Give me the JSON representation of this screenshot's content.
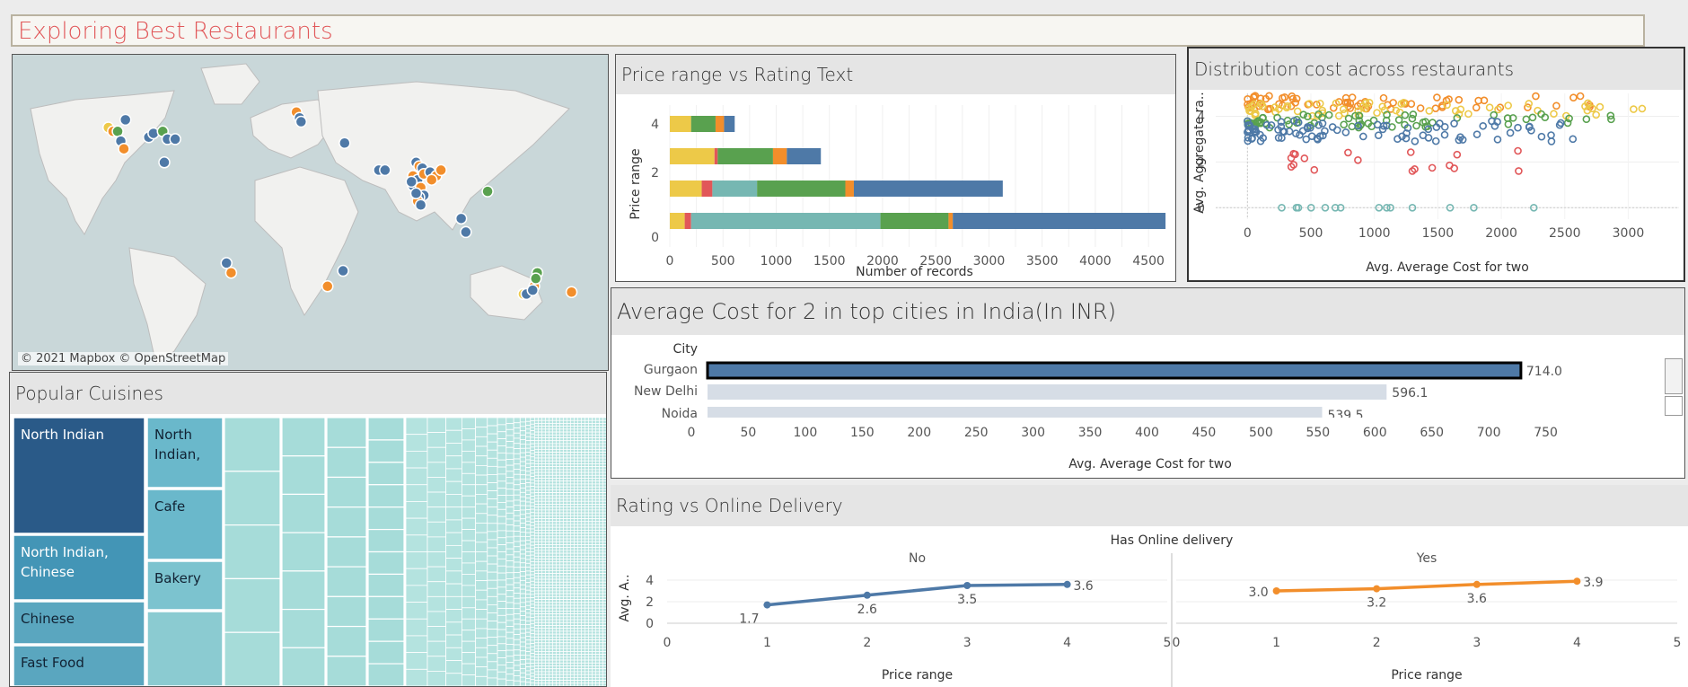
{
  "dashboard": {
    "title": "Exploring Best Restaurants"
  },
  "colors": {
    "blue": "#4e79a7",
    "orange": "#f28e2b",
    "green": "#59a14f",
    "yellow": "#edc948",
    "red": "#e15759",
    "teal": "#76b7b2",
    "light": "#d6dde6",
    "title": "#e15759"
  },
  "map": {
    "attribution": "© 2021 Mapbox © OpenStreetMap",
    "points": [
      {
        "lon": -123,
        "lat": 48,
        "c": "yellow"
      },
      {
        "lon": -120,
        "lat": 46,
        "c": "orange"
      },
      {
        "lon": -117,
        "lat": 46,
        "c": "green"
      },
      {
        "lon": -112,
        "lat": 52,
        "c": "blue"
      },
      {
        "lon": -115,
        "lat": 41,
        "c": "blue"
      },
      {
        "lon": -113,
        "lat": 37,
        "c": "orange"
      },
      {
        "lon": -97,
        "lat": 43,
        "c": "blue"
      },
      {
        "lon": -94,
        "lat": 45,
        "c": "blue"
      },
      {
        "lon": -88,
        "lat": 46,
        "c": "green"
      },
      {
        "lon": -85,
        "lat": 42,
        "c": "blue"
      },
      {
        "lon": -80,
        "lat": 42,
        "c": "blue"
      },
      {
        "lon": -87,
        "lat": 30,
        "c": "blue"
      },
      {
        "lon": -47,
        "lat": -22,
        "c": "blue"
      },
      {
        "lon": -44,
        "lat": -27,
        "c": "orange"
      },
      {
        "lon": -2,
        "lat": 56,
        "c": "orange"
      },
      {
        "lon": 0,
        "lat": 53,
        "c": "blue"
      },
      {
        "lon": 1,
        "lat": 51,
        "c": "blue"
      },
      {
        "lon": 29,
        "lat": 40,
        "c": "blue"
      },
      {
        "lon": 51,
        "lat": 26,
        "c": "blue"
      },
      {
        "lon": 55,
        "lat": 26,
        "c": "blue"
      },
      {
        "lon": 75,
        "lat": 30,
        "c": "blue"
      },
      {
        "lon": 77,
        "lat": 28,
        "c": "orange"
      },
      {
        "lon": 79,
        "lat": 27,
        "c": "blue"
      },
      {
        "lon": 73,
        "lat": 23,
        "c": "orange"
      },
      {
        "lon": 76,
        "lat": 21,
        "c": "blue"
      },
      {
        "lon": 80,
        "lat": 24,
        "c": "orange"
      },
      {
        "lon": 84,
        "lat": 25,
        "c": "blue"
      },
      {
        "lon": 88,
        "lat": 23,
        "c": "orange"
      },
      {
        "lon": 73,
        "lat": 18,
        "c": "blue"
      },
      {
        "lon": 78,
        "lat": 17,
        "c": "orange"
      },
      {
        "lon": 80,
        "lat": 13,
        "c": "blue"
      },
      {
        "lon": 77,
        "lat": 12,
        "c": "blue"
      },
      {
        "lon": 76,
        "lat": 10,
        "c": "orange"
      },
      {
        "lon": 78,
        "lat": 8,
        "c": "blue"
      },
      {
        "lon": 75,
        "lat": 14,
        "c": "blue"
      },
      {
        "lon": 72,
        "lat": 20,
        "c": "blue"
      },
      {
        "lon": 85,
        "lat": 21,
        "c": "orange"
      },
      {
        "lon": 91,
        "lat": 26,
        "c": "orange"
      },
      {
        "lon": 121,
        "lat": 15,
        "c": "green"
      },
      {
        "lon": 104,
        "lat": 1,
        "c": "blue"
      },
      {
        "lon": 107,
        "lat": -6,
        "c": "blue"
      },
      {
        "lon": 18,
        "lat": -34,
        "c": "orange"
      },
      {
        "lon": 28,
        "lat": -26,
        "c": "blue"
      },
      {
        "lon": 144,
        "lat": -38,
        "c": "yellow"
      },
      {
        "lon": 146,
        "lat": -38,
        "c": "blue"
      },
      {
        "lon": 151,
        "lat": -34,
        "c": "orange"
      },
      {
        "lon": 153,
        "lat": -27,
        "c": "green"
      },
      {
        "lon": 152,
        "lat": -30,
        "c": "green"
      },
      {
        "lon": 150,
        "lat": -36,
        "c": "blue"
      },
      {
        "lon": 175,
        "lat": -37,
        "c": "orange"
      }
    ]
  },
  "price_rating": {
    "title": "Price range vs Rating Text",
    "chart_data": {
      "type": "bar",
      "orientation": "horizontal",
      "stacked": true,
      "categories": [
        "4",
        "3",
        "2",
        "1"
      ],
      "ylabel": "Price range",
      "xlabel": "Number of records",
      "xlim": [
        0,
        4600
      ],
      "xticks": [
        "0",
        "500",
        "1000",
        "1500",
        "2000",
        "2500",
        "3000",
        "3500",
        "4000",
        "4500"
      ],
      "yticks": [
        "4",
        "2",
        "0"
      ],
      "bars": [
        [
          {
            "c": "yellow",
            "v": 200
          },
          {
            "c": "green",
            "v": 230
          },
          {
            "c": "orange",
            "v": 80
          },
          {
            "c": "blue",
            "v": 100
          }
        ],
        [
          {
            "c": "yellow",
            "v": 420
          },
          {
            "c": "red",
            "v": 30
          },
          {
            "c": "green",
            "v": 520
          },
          {
            "c": "orange",
            "v": 130
          },
          {
            "c": "blue",
            "v": 320
          }
        ],
        [
          {
            "c": "yellow",
            "v": 300
          },
          {
            "c": "red",
            "v": 100
          },
          {
            "c": "teal",
            "v": 420
          },
          {
            "c": "green",
            "v": 830
          },
          {
            "c": "orange",
            "v": 80
          },
          {
            "c": "blue",
            "v": 1400
          }
        ],
        [
          {
            "c": "yellow",
            "v": 140
          },
          {
            "c": "red",
            "v": 60
          },
          {
            "c": "teal",
            "v": 1780
          },
          {
            "c": "green",
            "v": 640
          },
          {
            "c": "orange",
            "v": 40
          },
          {
            "c": "blue",
            "v": 2000
          }
        ]
      ]
    }
  },
  "distribution": {
    "title": "Distribution cost across restaurants",
    "chart_data": {
      "type": "scatter",
      "xlabel": "Avg. Average Cost for two",
      "ylabel": "Avg. Aggregate ra..",
      "xlim": [
        -250,
        3400
      ],
      "ylim": [
        -0.5,
        5
      ],
      "xticks": [
        "0",
        "500",
        "1000",
        "1500",
        "2000",
        "2500",
        "3000"
      ],
      "yticks": [
        "4",
        "2",
        "0"
      ]
    }
  },
  "avg_cost": {
    "title": "Average Cost for 2 in top cities in India(In INR)",
    "column_header": "City",
    "chart_data": {
      "type": "bar",
      "orientation": "horizontal",
      "xlabel": "Avg. Average Cost for two",
      "xlim": [
        0,
        800
      ],
      "xticks": [
        "0",
        "50",
        "100",
        "150",
        "200",
        "250",
        "300",
        "350",
        "400",
        "450",
        "500",
        "550",
        "600",
        "650",
        "700",
        "750"
      ],
      "categories": [
        "Gurgaon",
        "New Delhi",
        "Noida"
      ],
      "values": [
        714.0,
        596.1,
        539.5
      ],
      "labels": [
        "714.0",
        "596.1",
        "539.5"
      ]
    }
  },
  "cuisines": {
    "title": "Popular Cuisines",
    "tiles": [
      "North Indian",
      "North Indian, Chinese",
      "Chinese",
      "Fast Food",
      "North Indian,",
      "Cafe",
      "Bakery"
    ]
  },
  "delivery": {
    "title": "Rating vs Online Delivery",
    "header": "Has Online delivery",
    "ylabel": "Avg. A..",
    "xlabel": "Price range",
    "xticks": [
      "0",
      "1",
      "2",
      "3",
      "4",
      "5"
    ],
    "yticks": [
      "4",
      "2",
      "0"
    ],
    "chart_data": {
      "type": "line",
      "x": [
        1,
        2,
        3,
        4
      ],
      "series": [
        {
          "name": "No",
          "values": [
            1.7,
            2.6,
            3.5,
            3.6
          ],
          "labels": [
            "1.7",
            "2.6",
            "3.5",
            "3.6"
          ]
        },
        {
          "name": "Yes",
          "values": [
            3.0,
            3.2,
            3.6,
            3.9
          ],
          "labels": [
            "3.0",
            "3.2",
            "3.6",
            "3.9"
          ]
        }
      ]
    }
  }
}
